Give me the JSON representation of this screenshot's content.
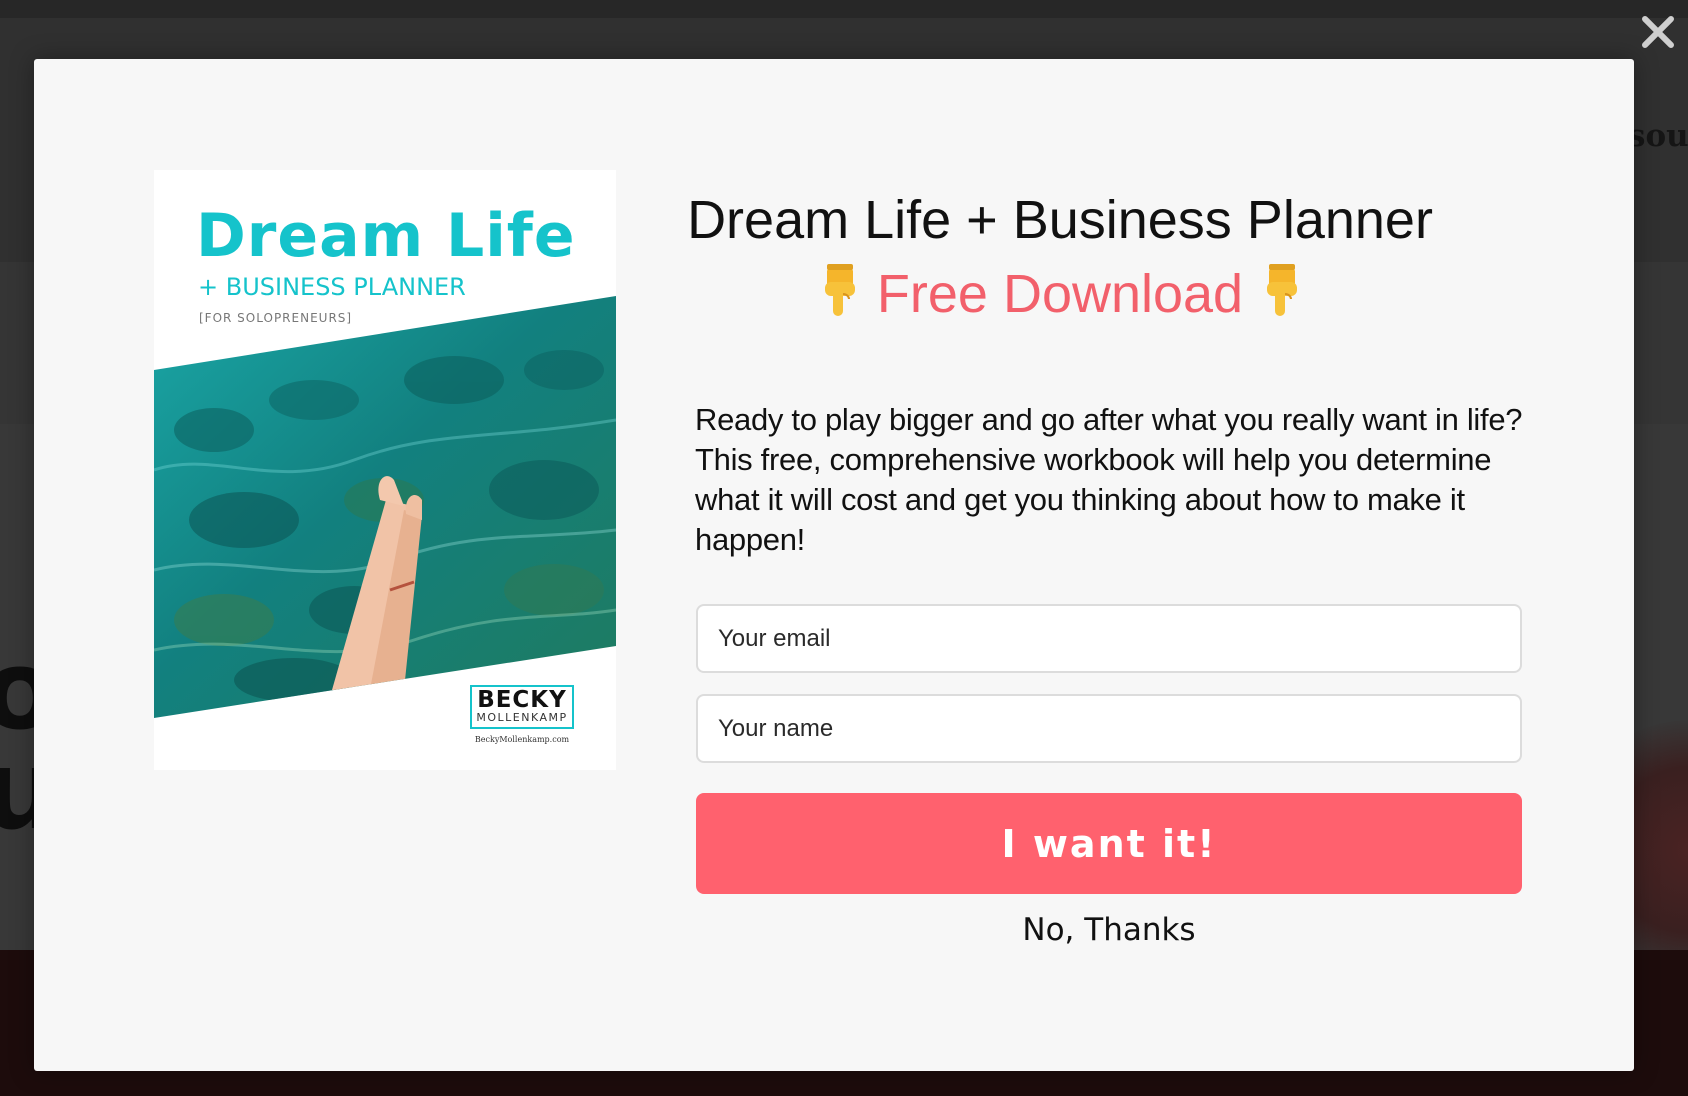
{
  "background": {
    "nav_text": "sour",
    "hero_letters": "o\nu"
  },
  "modal": {
    "close_icon": "close-icon",
    "cover": {
      "title": "Dream Life",
      "subtitle": "+ BUSINESS PLANNER",
      "tag": "[FOR SOLOPRENEURS]",
      "logo_name": "BECKY",
      "logo_surname": "MOLLENKAMP",
      "url": "BeckyMollenkamp.com"
    },
    "headline": "Dream Life + Business Planner",
    "subheadline": "Free Download",
    "subheadline_icon": "pointing-down-hand-icon",
    "description": "Ready to play bigger and go after what you really want in life? This free, comprehensive workbook will help you determine what it will cost and get you thinking about how to make it happen!",
    "email_field": {
      "placeholder": "Your email",
      "value": ""
    },
    "name_field": {
      "placeholder": "Your name",
      "value": ""
    },
    "submit_label": "I want it!",
    "decline_label": "No, Thanks"
  },
  "colors": {
    "accent_coral": "#ff616e",
    "subheadline_coral": "#f2606b",
    "cover_teal": "#15c3cb",
    "modal_bg": "#f7f7f7",
    "overlay": "#2a2a2a"
  }
}
